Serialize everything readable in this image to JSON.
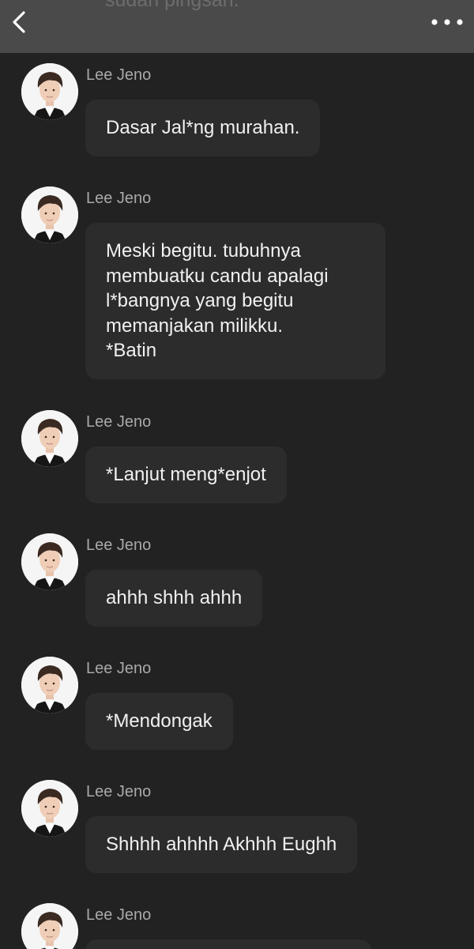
{
  "header": {
    "partial_text": "sudah pingsan.",
    "back_icon": "chevron-left-icon",
    "more_icon": "more-horizontal-icon"
  },
  "messages": [
    {
      "sender": "Lee Jeno",
      "text": "Dasar Jal*ng murahan."
    },
    {
      "sender": "Lee Jeno",
      "text": "Meski begitu. tubuhnya\nmembuatku candu apalagi\nl*bangnya yang begitu\nmemanjakan milikku.\n*Batin"
    },
    {
      "sender": "Lee Jeno",
      "text": "*Lanjut meng*enjot"
    },
    {
      "sender": "Lee Jeno",
      "text": "ahhh shhh ahhh"
    },
    {
      "sender": "Lee Jeno",
      "text": "*Mendongak"
    },
    {
      "sender": "Lee Jeno",
      "text": "Shhhh ahhhh Akhhh Eughh"
    },
    {
      "sender": "Lee Jeno",
      "text": ""
    }
  ],
  "colors": {
    "background": "#222222",
    "header": "#4a4a4a",
    "bubble": "#2c2c2c",
    "sender": "#a9a9a9",
    "text": "#f1f1f1"
  }
}
